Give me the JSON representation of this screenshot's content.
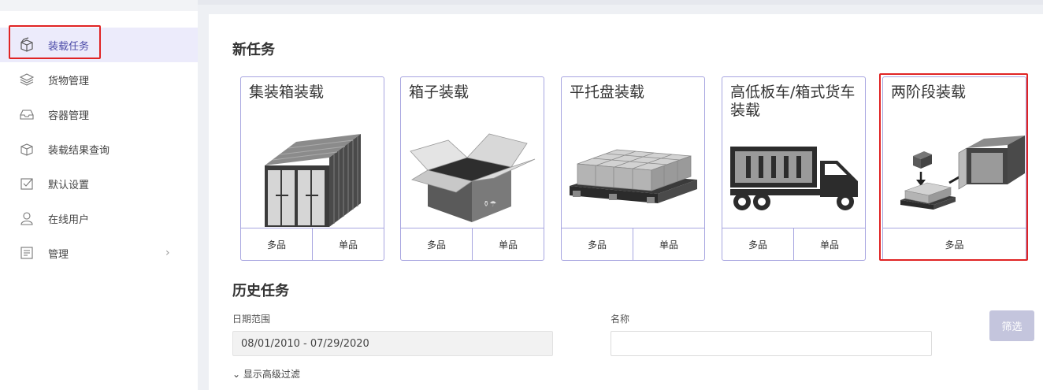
{
  "sidebar": {
    "items": [
      {
        "label": "装载任务",
        "icon": "cube-open-icon"
      },
      {
        "label": "货物管理",
        "icon": "layers-icon"
      },
      {
        "label": "容器管理",
        "icon": "tray-icon"
      },
      {
        "label": "装载结果查询",
        "icon": "cube-search-icon"
      },
      {
        "label": "默认设置",
        "icon": "checkbox-icon"
      },
      {
        "label": "在线用户",
        "icon": "user-icon"
      },
      {
        "label": "管理",
        "icon": "admin-icon",
        "chevron": "›"
      }
    ]
  },
  "new_task": {
    "title": "新任务",
    "cards": [
      {
        "title": "集装箱装载",
        "buttons": [
          "多品",
          "单品"
        ]
      },
      {
        "title": "箱子装载",
        "buttons": [
          "多品",
          "单品"
        ]
      },
      {
        "title": "平托盘装载",
        "buttons": [
          "多品",
          "单品"
        ]
      },
      {
        "title": "高低板车/箱式货车装载",
        "buttons": [
          "多品",
          "单品"
        ]
      },
      {
        "title": "两阶段装载",
        "buttons": [
          "多品"
        ]
      }
    ]
  },
  "history": {
    "title": "历史任务",
    "date_label": "日期范围",
    "date_value": "08/01/2010 - 07/29/2020",
    "name_label": "名称",
    "name_value": "",
    "filter_button": "筛选",
    "advanced_toggle": "显示高级过滤"
  },
  "colors": {
    "accent": "#4b4aa8",
    "card_border": "#a7a5e0",
    "highlight": "#e02424"
  }
}
